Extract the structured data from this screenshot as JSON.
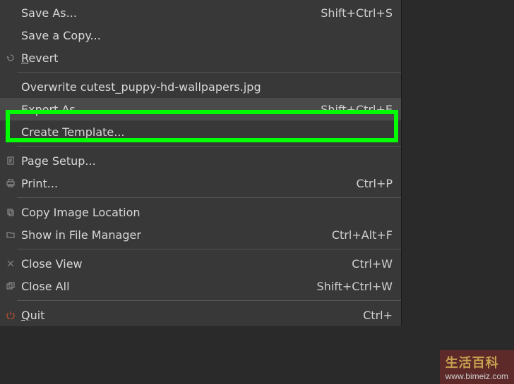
{
  "menu": {
    "items": [
      {
        "label": "Save As...",
        "shortcut": "Shift+Ctrl+S",
        "icon": ""
      },
      {
        "label": "Save a Copy...",
        "shortcut": "",
        "icon": ""
      },
      {
        "label": "Revert",
        "shortcut": "",
        "icon": "revert"
      },
      {
        "sep": true
      },
      {
        "label": "Overwrite cutest_puppy-hd-wallpapers.jpg",
        "shortcut": "",
        "icon": ""
      },
      {
        "label": "Export As...",
        "shortcut": "Shift+Ctrl+E",
        "icon": "",
        "hl": true
      },
      {
        "label": "Create Template...",
        "shortcut": "",
        "icon": ""
      },
      {
        "sep": true
      },
      {
        "label": "Page Setup...",
        "shortcut": "",
        "icon": "page"
      },
      {
        "label": "Print...",
        "shortcut": "Ctrl+P",
        "icon": "print"
      },
      {
        "sep": true
      },
      {
        "label": "Copy Image Location",
        "shortcut": "",
        "icon": "copy"
      },
      {
        "label": "Show in File Manager",
        "shortcut": "Ctrl+Alt+F",
        "icon": "folder"
      },
      {
        "sep": true
      },
      {
        "label": "Close View",
        "shortcut": "Ctrl+W",
        "icon": "close"
      },
      {
        "label": "Close All",
        "shortcut": "Shift+Ctrl+W",
        "icon": "closeall"
      },
      {
        "sep": true
      },
      {
        "label": "Quit",
        "shortcut": "Ctrl+",
        "icon": "quit"
      }
    ]
  },
  "watermark": {
    "text": "生活百科",
    "url": "www.bimeiz.com"
  }
}
